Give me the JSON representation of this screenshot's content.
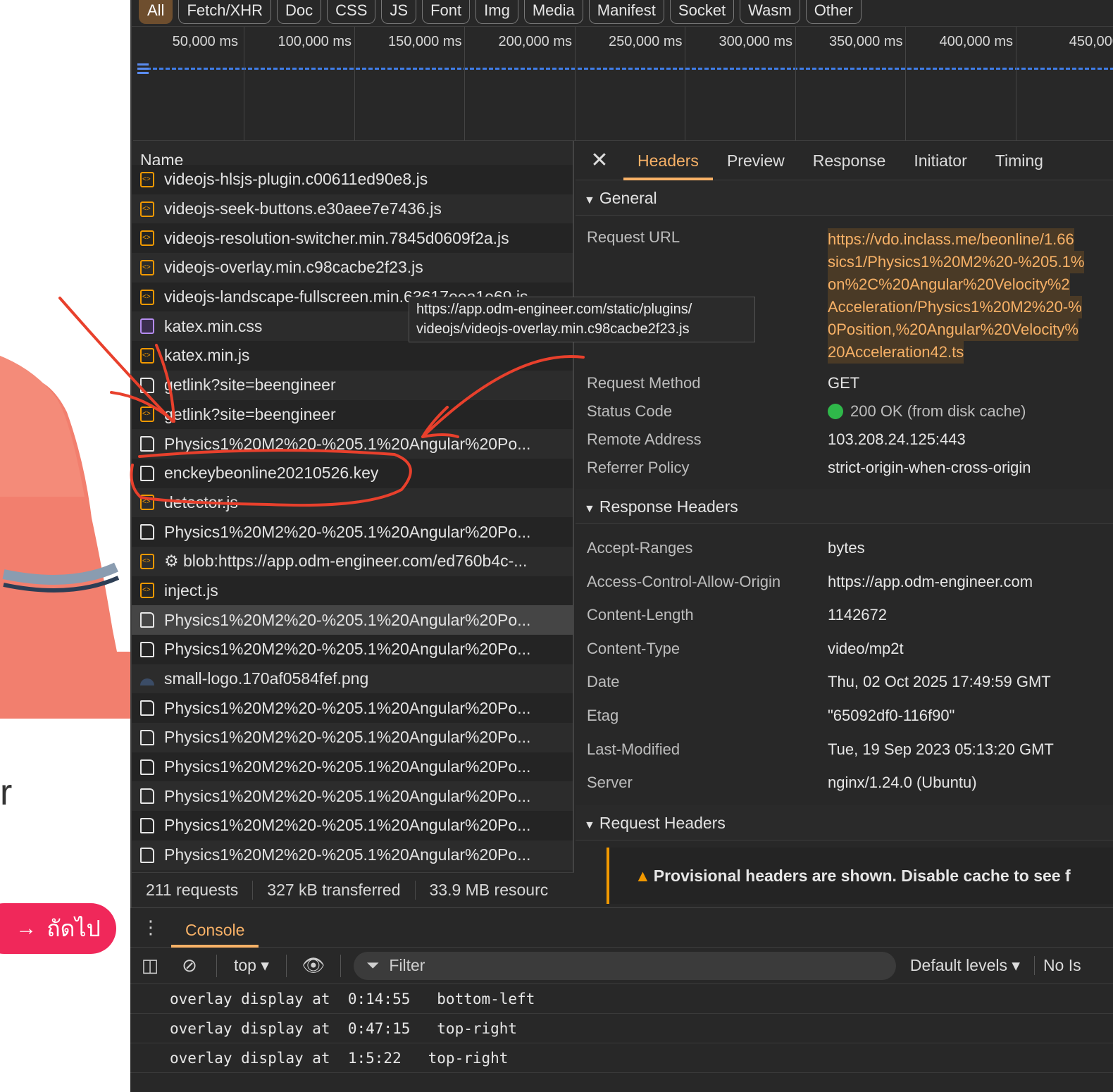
{
  "left_page": {
    "stray_letter": "r",
    "next_button_label": "ถัดไป"
  },
  "filter_bar": {
    "chips": [
      "All",
      "Fetch/XHR",
      "Doc",
      "CSS",
      "JS",
      "Font",
      "Img",
      "Media",
      "Manifest",
      "Socket",
      "Wasm",
      "Other"
    ],
    "active": "All"
  },
  "timeline": {
    "ticks": [
      "50,000 ms",
      "100,000 ms",
      "150,000 ms",
      "200,000 ms",
      "250,000 ms",
      "300,000 ms",
      "350,000 ms",
      "400,000 ms",
      "450,000"
    ],
    "line_color": "#3f7de8"
  },
  "request_list": {
    "header": "Name",
    "rows": [
      {
        "name": "videojs-hlsjs-plugin.c00611ed90e8.js",
        "type": "script"
      },
      {
        "name": "videojs-seek-buttons.e30aee7e7436.js",
        "type": "script"
      },
      {
        "name": "videojs-resolution-switcher.min.7845d0609f2a.js",
        "type": "script"
      },
      {
        "name": "videojs-overlay.min.c98cacbe2f23.js",
        "type": "script"
      },
      {
        "name": "videojs-landscape-fullscreen.min.63617eea1e69.js",
        "type": "script"
      },
      {
        "name": "katex.min.css",
        "type": "css"
      },
      {
        "name": "katex.min.js",
        "type": "script"
      },
      {
        "name": "getlink?site=beengineer",
        "type": "doc"
      },
      {
        "name": "getlink?site=beengineer",
        "type": "script"
      },
      {
        "name": "Physics1%20M2%20-%205.1%20Angular%20Po...",
        "type": "doc"
      },
      {
        "name": "enckeybeonline20210526.key",
        "type": "doc"
      },
      {
        "name": "detector.js",
        "type": "script"
      },
      {
        "name": "Physics1%20M2%20-%205.1%20Angular%20Po...",
        "type": "doc"
      },
      {
        "name": "⚙ blob:https://app.odm-engineer.com/ed760b4c-...",
        "type": "script"
      },
      {
        "name": "inject.js",
        "type": "script"
      },
      {
        "name": "Physics1%20M2%20-%205.1%20Angular%20Po...",
        "type": "doc",
        "selected": true
      },
      {
        "name": "Physics1%20M2%20-%205.1%20Angular%20Po...",
        "type": "doc"
      },
      {
        "name": "small-logo.170af0584fef.png",
        "type": "img"
      },
      {
        "name": "Physics1%20M2%20-%205.1%20Angular%20Po...",
        "type": "doc"
      },
      {
        "name": "Physics1%20M2%20-%205.1%20Angular%20Po...",
        "type": "doc"
      },
      {
        "name": "Physics1%20M2%20-%205.1%20Angular%20Po...",
        "type": "doc"
      },
      {
        "name": "Physics1%20M2%20-%205.1%20Angular%20Po...",
        "type": "doc"
      },
      {
        "name": "Physics1%20M2%20-%205.1%20Angular%20Po...",
        "type": "doc"
      },
      {
        "name": "Physics1%20M2%20-%205.1%20Angular%20Po...",
        "type": "doc"
      }
    ]
  },
  "status_bar": {
    "requests": "211 requests",
    "transferred": "327 kB transferred",
    "resources": "33.9 MB resourc"
  },
  "tooltip": {
    "line1": "https://app.odm-engineer.com/static/plugins/",
    "line2": "videojs/videojs-overlay.min.c98cacbe2f23.js"
  },
  "details": {
    "tabs": [
      "Headers",
      "Preview",
      "Response",
      "Initiator",
      "Timing"
    ],
    "active_tab": "Headers",
    "general": {
      "title": "General",
      "request_url_label": "Request URL",
      "request_url_lines": [
        "https://vdo.inclass.me/beonline/1.66",
        "sics1/Physics1%20M2%20-%205.1%",
        "on%2C%20Angular%20Velocity%2",
        "Acceleration/Physics1%20M2%20-%",
        "0Position,%20Angular%20Velocity%",
        "20Acceleration42.ts"
      ],
      "method_label": "Request Method",
      "method": "GET",
      "status_label": "Status Code",
      "status": "200 OK (from disk cache)",
      "remote_label": "Remote Address",
      "remote": "103.208.24.125:443",
      "referrer_label": "Referrer Policy",
      "referrer": "strict-origin-when-cross-origin"
    },
    "response_headers": {
      "title": "Response Headers",
      "items": [
        {
          "k": "Accept-Ranges",
          "v": "bytes"
        },
        {
          "k": "Access-Control-Allow-Origin",
          "v": "https://app.odm-engineer.com"
        },
        {
          "k": "Content-Length",
          "v": "1142672"
        },
        {
          "k": "Content-Type",
          "v": "video/mp2t"
        },
        {
          "k": "Date",
          "v": "Thu, 02 Oct 2025 17:49:59 GMT"
        },
        {
          "k": "Etag",
          "v": "\"65092df0-116f90\""
        },
        {
          "k": "Last-Modified",
          "v": "Tue, 19 Sep 2023 05:13:20 GMT"
        },
        {
          "k": "Server",
          "v": "nginx/1.24.0 (Ubuntu)"
        }
      ]
    },
    "request_headers": {
      "title": "Request Headers",
      "warning": "Provisional headers are shown. Disable cache to see f"
    }
  },
  "console": {
    "tab": "Console",
    "context": "top",
    "filter_placeholder": "Filter",
    "levels": "Default levels",
    "issues": "No Is",
    "logs": [
      "overlay display at  0:14:55   bottom-left",
      "overlay display at  0:47:15   top-right",
      "overlay display at  1:5:22   top-right"
    ]
  },
  "colors": {
    "accent": "#f7b167",
    "annotation_red": "#e8402c",
    "status_green": "#2fb84a",
    "button_pink": "#f0285a"
  }
}
